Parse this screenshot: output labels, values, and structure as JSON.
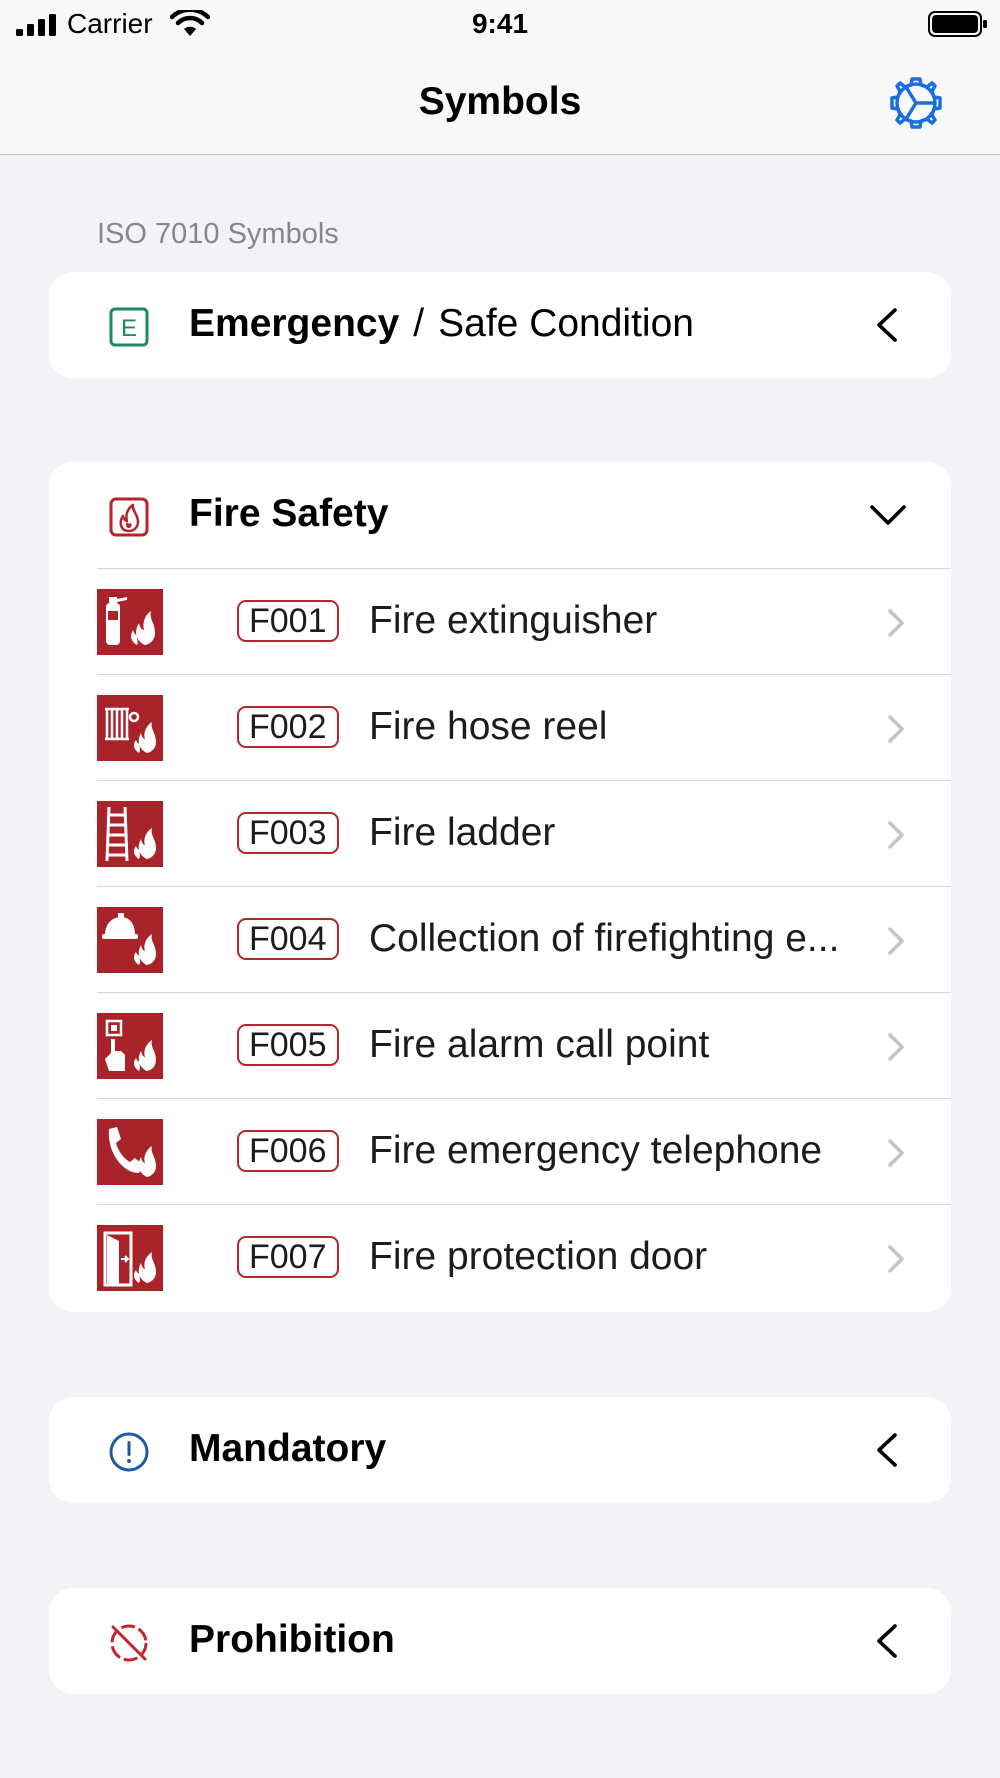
{
  "status_bar": {
    "carrier": "Carrier",
    "time": "9:41"
  },
  "nav": {
    "title": "Symbols",
    "settings_icon": "gear-icon"
  },
  "colors": {
    "accent": "#1a6fe0",
    "fire_red": "#a8242a",
    "emergency_green": "#1e8a58",
    "mandatory_blue": "#1f5aa0",
    "prohibition_red": "#c0262d"
  },
  "section_header": "ISO 7010 Symbols",
  "groups": {
    "emergency": {
      "code": "E",
      "title": "Emergency",
      "separator": "/",
      "subtitle": "Safe Condition",
      "expanded": false
    },
    "fire": {
      "title": "Fire Safety",
      "expanded": true,
      "items": [
        {
          "code": "F001",
          "label": "Fire extinguisher",
          "icon": "fire-extinguisher-icon"
        },
        {
          "code": "F002",
          "label": "Fire hose reel",
          "icon": "fire-hose-reel-icon"
        },
        {
          "code": "F003",
          "label": "Fire ladder",
          "icon": "fire-ladder-icon"
        },
        {
          "code": "F004",
          "label": "Collection of firefighting e...",
          "icon": "firefighting-equipment-icon"
        },
        {
          "code": "F005",
          "label": "Fire alarm call point",
          "icon": "fire-alarm-call-point-icon"
        },
        {
          "code": "F006",
          "label": "Fire emergency telephone",
          "icon": "fire-telephone-icon"
        },
        {
          "code": "F007",
          "label": "Fire protection door",
          "icon": "fire-door-icon"
        }
      ]
    },
    "mandatory": {
      "title": "Mandatory",
      "expanded": false
    },
    "prohibition": {
      "title": "Prohibition",
      "expanded": false
    }
  }
}
